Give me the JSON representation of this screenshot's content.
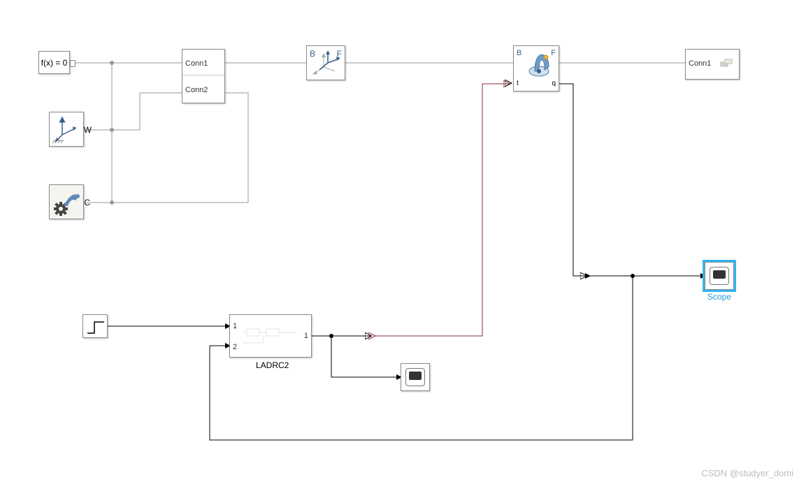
{
  "blocks": {
    "solver": {
      "label": "f(x) = 0"
    },
    "worldframe": {
      "port_label": "W"
    },
    "mechconfig": {
      "port_label": "C"
    },
    "subsystem1": {
      "port1": "Conn1",
      "port2": "Conn2"
    },
    "rigidtransform": {
      "port_b": "B",
      "port_f": "F"
    },
    "revolute": {
      "port_b": "B",
      "port_f": "F",
      "port_t": "t",
      "port_q": "q"
    },
    "link_solid": {
      "port": "Conn1"
    },
    "step": {},
    "ladrc": {
      "name": "LADRC2",
      "in1": "1",
      "in2": "2",
      "out1": "1"
    },
    "scope_small": {},
    "scope_main": {
      "name": "Scope"
    }
  },
  "watermark": "CSDN @studyer_domi"
}
